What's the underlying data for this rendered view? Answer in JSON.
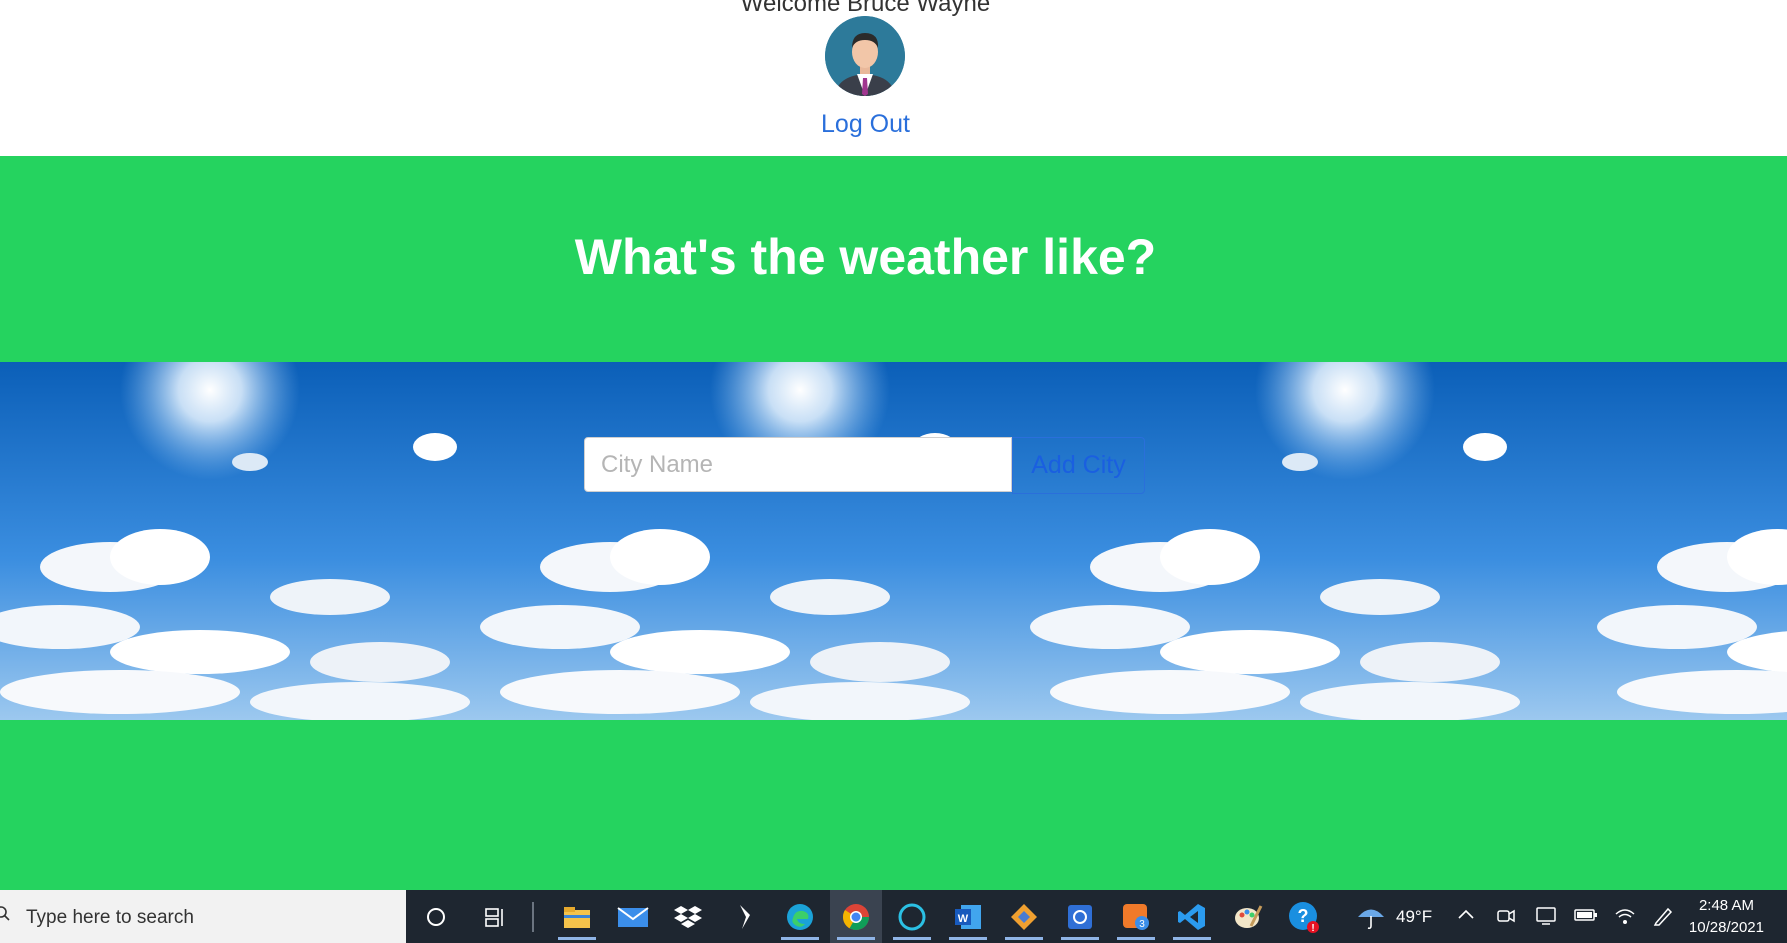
{
  "header": {
    "welcome": "Welcome Bruce Wayne",
    "logout_label": "Log Out"
  },
  "main": {
    "headline": "What's the weather like?",
    "city_input": {
      "placeholder": "City Name",
      "value": ""
    },
    "add_button_label": "Add City"
  },
  "colors": {
    "green_band": "#25d35f",
    "link_blue": "#2a6fdb",
    "taskbar": "#1e2630"
  },
  "taskbar": {
    "search_placeholder": "Type here to search",
    "apps": [
      "cortana-icon",
      "task-view-icon",
      "file-explorer-icon",
      "mail-icon",
      "dropbox-icon",
      "app-icon",
      "edge-icon",
      "chrome-icon",
      "alexa-icon",
      "word-icon",
      "git-icon",
      "chat-app-icon",
      "notification-app-icon",
      "vscode-icon",
      "paint-icon",
      "help-icon"
    ],
    "weather_temp": "49°F",
    "time": "2:48 AM",
    "date": "10/28/2021"
  }
}
